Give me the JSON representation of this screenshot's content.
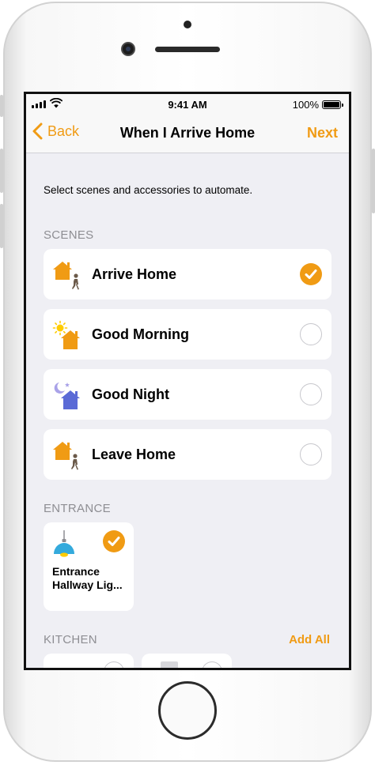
{
  "status_bar": {
    "time": "9:41 AM",
    "battery": "100%"
  },
  "nav": {
    "back_label": "Back",
    "title": "When I Arrive Home",
    "next_label": "Next"
  },
  "intro_text": "Select scenes and accessories to automate.",
  "sections": {
    "scenes": {
      "header": "SCENES",
      "items": [
        {
          "label": "Arrive Home",
          "icon": "arrive-home-icon",
          "selected": true
        },
        {
          "label": "Good Morning",
          "icon": "good-morning-icon",
          "selected": false
        },
        {
          "label": "Good Night",
          "icon": "good-night-icon",
          "selected": false
        },
        {
          "label": "Leave Home",
          "icon": "leave-home-icon",
          "selected": false
        }
      ]
    },
    "entrance": {
      "header": "ENTRANCE",
      "accessories": [
        {
          "label": "Entrance Hallway Lig...",
          "icon": "pendant-light-icon",
          "selected": true
        }
      ]
    },
    "kitchen": {
      "header": "KITCHEN",
      "add_all_label": "Add All"
    }
  },
  "colors": {
    "accent": "#f09b14",
    "background": "#efeff4",
    "card": "#ffffff",
    "night_house": "#5a6ad6",
    "lamp": "#34aadc"
  }
}
